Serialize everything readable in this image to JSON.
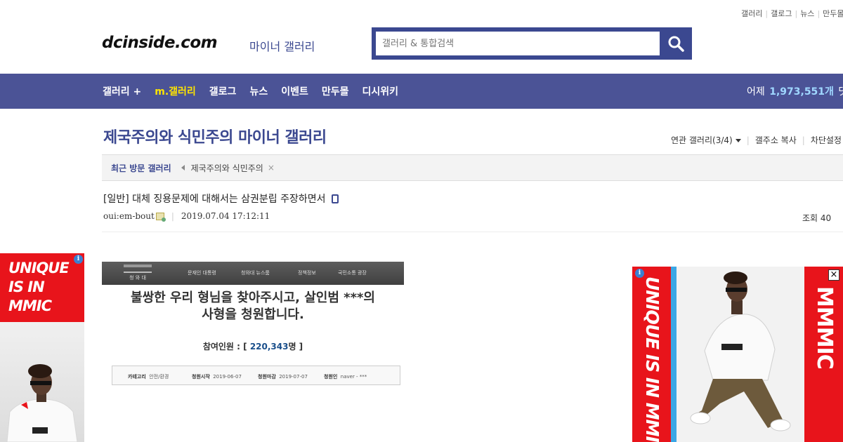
{
  "top_links": [
    "갤러리",
    "갤로그",
    "뉴스",
    "만두몰"
  ],
  "logo": {
    "text": "dcinside.com",
    "subtitle": "마이너 갤러리"
  },
  "search": {
    "placeholder": "갤러리 & 통합검색",
    "icon": "search-icon"
  },
  "nav": {
    "items": [
      {
        "label": "갤러리 +",
        "active": false
      },
      {
        "label": "m.갤러리",
        "active": true
      },
      {
        "label": "갤로그",
        "active": false
      },
      {
        "label": "뉴스",
        "active": false
      },
      {
        "label": "이벤트",
        "active": false
      },
      {
        "label": "만두몰",
        "active": false
      },
      {
        "label": "디시위키",
        "active": false
      }
    ],
    "stats_prefix": "어제",
    "stats_count": "1,973,551개",
    "stats_suffix": "댓글"
  },
  "gallery": {
    "title": "제국주의와 식민주의 마이너 갤러리",
    "related": "연관 갤러리(3/4)",
    "copy_address": "갤주소 복사",
    "block_settings": "차단설정"
  },
  "recent": {
    "label": "최근 방문 갤러리",
    "items": [
      "제국주의와 식민주의"
    ],
    "close": "×"
  },
  "post": {
    "title": "[일반] 대체 징용문제에 대해서는 삼권분립 주장하면서",
    "author": "oui:em-bout",
    "datetime": "2019.07.04 17:12:11",
    "views_label": "조회",
    "views": "40"
  },
  "petition": {
    "emblem_text": "청 와 대",
    "nav": [
      "문재인 대통령",
      "청와대 뉴스룸",
      "정책정보",
      "국민소통 광장"
    ],
    "title_line1": "불쌍한 우리 형님을 찾아주시고, 살인범 ***의",
    "title_line2": "사형을 청원합니다.",
    "count_label": "참여인원 : [",
    "count_value": "220,343",
    "count_suffix": "명 ]",
    "info": [
      {
        "k": "카테고리",
        "v": "안전/환경"
      },
      {
        "k": "청원시작",
        "v": "2019-06-07"
      },
      {
        "k": "청원마감",
        "v": "2019-07-07"
      },
      {
        "k": "청원인",
        "v": "naver - ***"
      }
    ]
  },
  "ads": {
    "left": {
      "line1": "UNIQUE",
      "line2": "IS IN",
      "line3": "MMIC",
      "info": "i"
    },
    "right": {
      "vertical_text": "UNIQUE IS IN MMIC",
      "brand": "MMMIC",
      "info": "i",
      "close": "×"
    },
    "brand_red": "#e8141b",
    "accent_blue": "#3ba7e6"
  },
  "colors": {
    "nav_bg": "#4b5396",
    "brand_blue": "#3b4890",
    "active_nav": "#ffe500"
  }
}
